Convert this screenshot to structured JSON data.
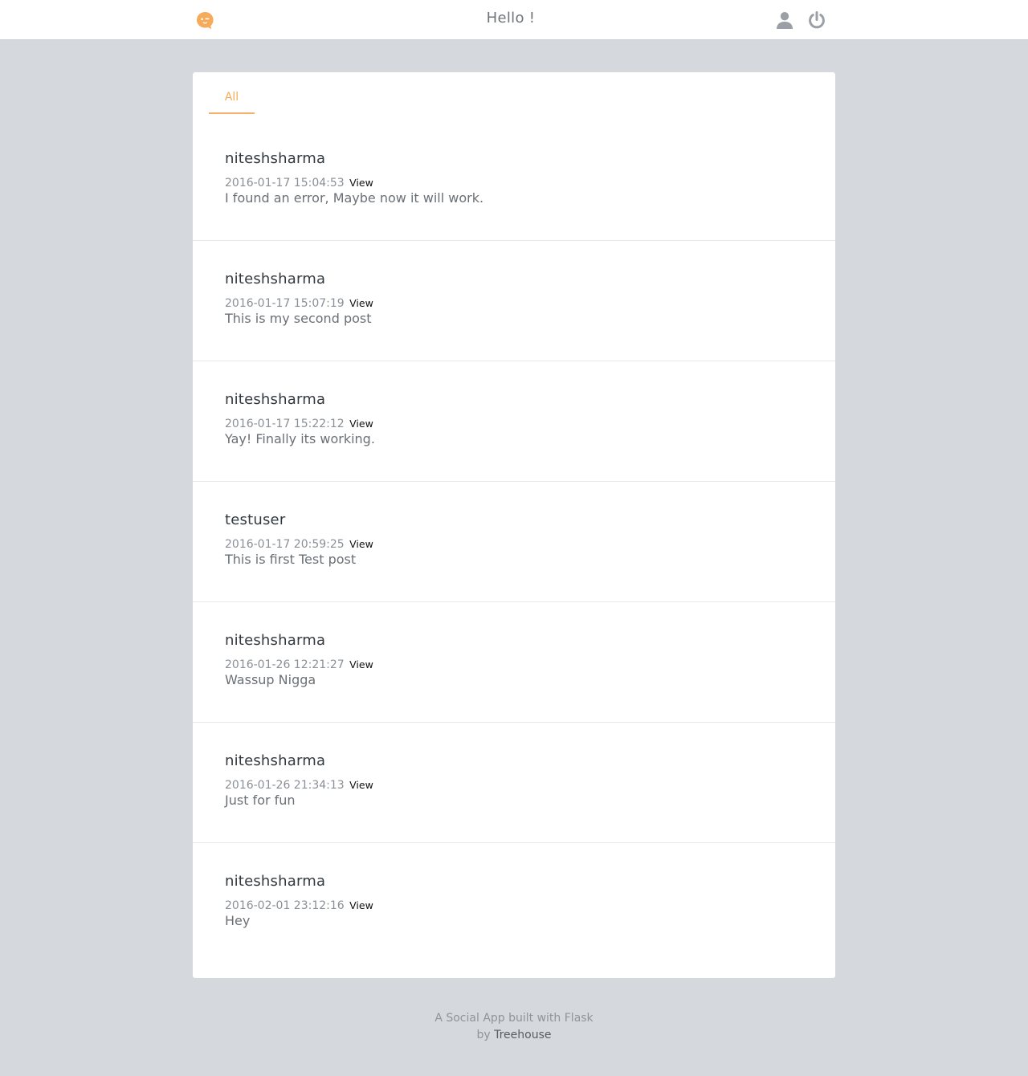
{
  "header": {
    "greeting": "Hello !",
    "logo_icon": "chat-bubble-face-icon",
    "profile_icon": "user-icon",
    "logout_icon": "power-icon",
    "accent_color": "#f6aa5a"
  },
  "tabs": [
    {
      "label": "All",
      "active": true
    }
  ],
  "posts": [
    {
      "user": "niteshsharma",
      "timestamp": "2016-01-17 15:04:53",
      "view_label": "View",
      "body": "I found an error, Maybe now it will work."
    },
    {
      "user": "niteshsharma",
      "timestamp": "2016-01-17 15:07:19",
      "view_label": "View",
      "body": "This is my second post"
    },
    {
      "user": "niteshsharma",
      "timestamp": "2016-01-17 15:22:12",
      "view_label": "View",
      "body": "Yay! Finally its working."
    },
    {
      "user": "testuser",
      "timestamp": "2016-01-17 20:59:25",
      "view_label": "View",
      "body": "This is first Test post"
    },
    {
      "user": "niteshsharma",
      "timestamp": "2016-01-26 12:21:27",
      "view_label": "View",
      "body": "Wassup Nigga"
    },
    {
      "user": "niteshsharma",
      "timestamp": "2016-01-26 21:34:13",
      "view_label": "View",
      "body": "Just for fun"
    },
    {
      "user": "niteshsharma",
      "timestamp": "2016-02-01 23:12:16",
      "view_label": "View",
      "body": "Hey"
    }
  ],
  "footer": {
    "line1": "A Social App built with Flask",
    "by_prefix": "by",
    "link_label": "Treehouse"
  }
}
